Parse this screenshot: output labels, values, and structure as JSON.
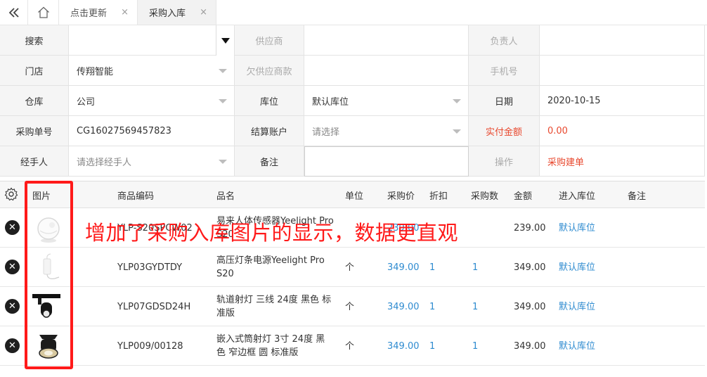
{
  "tabs": {
    "tab1_label": "点击更新",
    "tab2_label": "采购入库",
    "close_glyph": "×"
  },
  "form": {
    "search_label": "搜索",
    "supplier_label": "供应商",
    "manager_label": "负责人",
    "store_label": "门店",
    "store_value": "传翔智能",
    "owed_supplier_label": "欠供应商款",
    "phone_label": "手机号",
    "warehouse_label": "仓库",
    "warehouse_value": "公司",
    "location_label": "库位",
    "location_value": "默认库位",
    "date_label": "日期",
    "date_value": "2020-10-15",
    "order_no_label": "采购单号",
    "order_no_value": "CG16027569457823",
    "account_label": "结算账户",
    "account_placeholder": "请选择",
    "paid_label": "实付金额",
    "paid_value": "0.00",
    "handler_label": "经手人",
    "handler_placeholder": "请选择经手人",
    "remark_label": "备注",
    "op_label": "操作",
    "op_value": "采购建单"
  },
  "table": {
    "headers": {
      "image": "图片",
      "code": "商品编码",
      "name": "品名",
      "unit": "单位",
      "price": "采购价",
      "discount": "折扣",
      "qty": "采购数",
      "amount": "金额",
      "location": "进入库位",
      "remark": "备注"
    },
    "rows": [
      {
        "code": "YLP-S20SPCW02",
        "name_line1": "易来人体传感器Yeelight Pro",
        "name_line2": "S20",
        "unit": "",
        "price": "239.00",
        "discount": "",
        "qty": "",
        "amount": "239.00",
        "location": "默认库位",
        "image_icon": "motion-sensor-icon"
      },
      {
        "code": "YLP03GYDTDY",
        "name_line1": "高压灯条电源Yeelight Pro",
        "name_line2": "S20",
        "unit": "个",
        "price": "349.00",
        "discount": "1",
        "qty": "1",
        "amount": "349.00",
        "location": "默认库位",
        "image_icon": "power-supply-icon"
      },
      {
        "code": "YLP07GDSD24H",
        "name_line1": "轨道射灯 三线 24度 黑色 标",
        "name_line2": "准版",
        "unit": "个",
        "price": "349.00",
        "discount": "1",
        "qty": "1",
        "amount": "349.00",
        "location": "默认库位",
        "image_icon": "track-spotlight-icon"
      },
      {
        "code": "YLP009/00128",
        "name_line1": "嵌入式筒射灯 3寸 24度 黑",
        "name_line2": "色 窄边框 圆 标准版",
        "unit": "个",
        "price": "349.00",
        "discount": "1",
        "qty": "1",
        "amount": "349.00",
        "location": "默认库位",
        "image_icon": "downlight-icon"
      }
    ]
  },
  "annotation": "增加了采购入库图片的显示，数据更直观",
  "colors": {
    "accent_red": "#e8482e",
    "link_blue": "#2e8bd0",
    "annotation_red": "#ff1a1a"
  }
}
